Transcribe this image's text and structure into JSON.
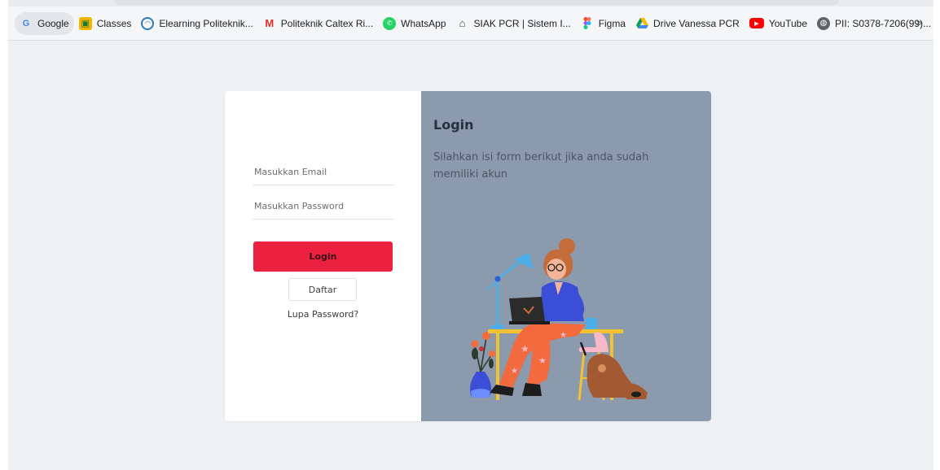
{
  "bookmarks": [
    {
      "label": "Google",
      "icon": "google-icon",
      "color": "#4285f4"
    },
    {
      "label": "Classes",
      "icon": "classroom-icon",
      "color": "#f4b400"
    },
    {
      "label": "Elearning Politeknik...",
      "icon": "elearning-icon",
      "color": "#2b7bb9"
    },
    {
      "label": "Politeknik Caltex Ri...",
      "icon": "gmail-icon",
      "color": "#d93025"
    },
    {
      "label": "WhatsApp",
      "icon": "whatsapp-icon",
      "color": "#25d366"
    },
    {
      "label": "SIAK PCR | Sistem I...",
      "icon": "building-icon",
      "color": "#5f6368"
    },
    {
      "label": "Figma",
      "icon": "figma-icon",
      "color": "#f24e1e"
    },
    {
      "label": "Drive Vanessa PCR",
      "icon": "drive-icon",
      "color": "#0f9d58"
    },
    {
      "label": "YouTube",
      "icon": "youtube-icon",
      "color": "#ff0000"
    },
    {
      "label": "PII: S0378-7206(99)...",
      "icon": "globe-icon",
      "color": "#5f6368"
    }
  ],
  "bookmarks_more": "»",
  "form": {
    "email_placeholder": "Masukkan Email",
    "password_placeholder": "Masukkan Password",
    "login_label": "Login",
    "register_label": "Daftar",
    "forgot_label": "Lupa Password?"
  },
  "info": {
    "title": "Login",
    "description": "Silahkan isi form berikut jika anda sudah memiliki akun"
  },
  "colors": {
    "accent": "#ec213f",
    "panel": "#8c9aad",
    "page_bg": "#edf1f4"
  }
}
